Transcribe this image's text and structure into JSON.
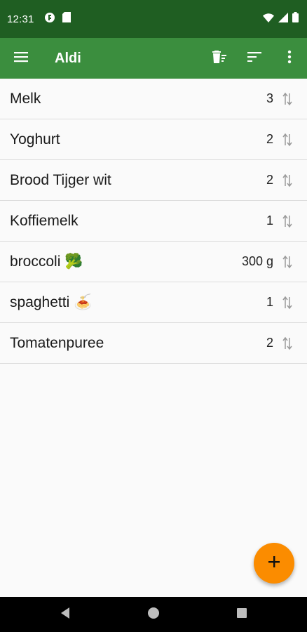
{
  "status_bar": {
    "time": "12:31",
    "left_icons": [
      "app-notification-icon",
      "sd-card-icon"
    ],
    "right_icons": [
      "wifi-icon",
      "signal-icon",
      "battery-icon"
    ]
  },
  "app_bar": {
    "title": "Aldi",
    "actions": [
      "clear-list-icon",
      "sort-icon",
      "more-vert-icon"
    ]
  },
  "items": [
    {
      "name": "Melk",
      "quantity": "3"
    },
    {
      "name": "Yoghurt",
      "quantity": "2"
    },
    {
      "name": "Brood Tijger wit",
      "quantity": "2"
    },
    {
      "name": "Koffiemelk",
      "quantity": "1"
    },
    {
      "name": "broccoli 🥦",
      "quantity": "300 g"
    },
    {
      "name": "spaghetti 🍝",
      "quantity": "1"
    },
    {
      "name": "Tomatenpuree",
      "quantity": "2"
    }
  ],
  "fab": {
    "icon": "add-icon"
  },
  "colors": {
    "status_bar": "#1f5e22",
    "app_bar": "#3b8e3e",
    "fab": "#fb8c00",
    "background": "#fafafa"
  }
}
